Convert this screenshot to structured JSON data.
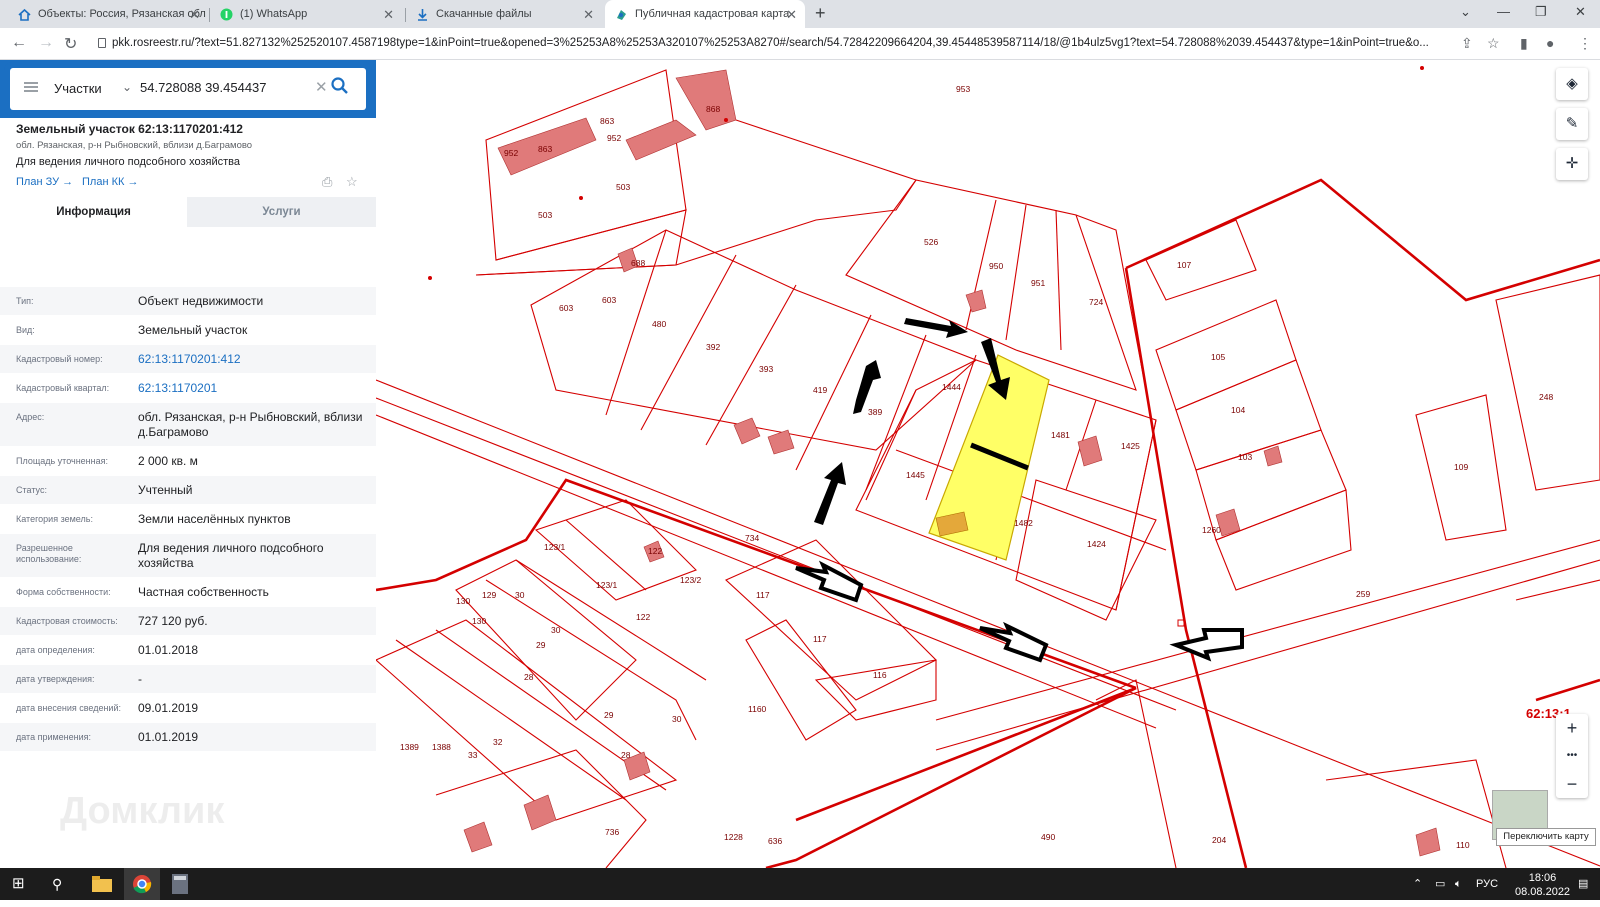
{
  "browser": {
    "tabs": [
      {
        "title": "Объекты: Россия, Рязанская обл",
        "icon": "home-icon"
      },
      {
        "title": "(1) WhatsApp",
        "icon": "whatsapp-icon"
      },
      {
        "title": "Скачанные файлы",
        "icon": "download-icon"
      },
      {
        "title": "Публичная кадастровая карта",
        "icon": "rosreestr-icon",
        "active": true
      }
    ],
    "new_tab": "+",
    "url": "pkk.rosreestr.ru/?text=51.827132%252520107.4587198type=1&inPoint=true&opened=3%25253A8%25253A320107%25253A8270#/search/54.72842209664204,39.45448539587114/18/@1b4ulz5vg1?text=54.728088%2039.454437&type=1&inPoint=true&o..."
  },
  "search": {
    "category": "Участки",
    "query": "54.728088 39.454437"
  },
  "parcel": {
    "title": "Земельный участок 62:13:1170201:412",
    "address_short": "обл. Рязанская, р-н Рыбновский, вблизи д.Баграмово",
    "use": "Для ведения личного подсобного хозяйства",
    "link_plan_zu": "План ЗУ →",
    "link_plan_kk": "План КК →"
  },
  "tabs": {
    "info": "Информация",
    "services": "Услуги"
  },
  "fields": [
    {
      "key": "Тип:",
      "value": "Объект недвижимости"
    },
    {
      "key": "Вид:",
      "value": "Земельный участок"
    },
    {
      "key": "Кадастровый номер:",
      "value": "62:13:1170201:412",
      "link": true
    },
    {
      "key": "Кадастровый квартал:",
      "value": "62:13:1170201",
      "link": true
    },
    {
      "key": "Адрес:",
      "value": "обл. Рязанская, р-н Рыбновский, вблизи д.Баграмово"
    },
    {
      "key": "Площадь уточненная:",
      "value": "2 000 кв. м"
    },
    {
      "key": "Статус:",
      "value": "Учтенный"
    },
    {
      "key": "Категория земель:",
      "value": "Земли населённых пунктов"
    },
    {
      "key": "Разрешенное использование:",
      "value": "Для ведения личного подсобного хозяйства"
    },
    {
      "key": "Форма собственности:",
      "value": "Частная собственность"
    },
    {
      "key": "Кадастровая стоимость:",
      "value": "727 120 руб."
    },
    {
      "key": "дата определения:",
      "value": "01.01.2018"
    },
    {
      "key": "дата утверждения:",
      "value": "-"
    },
    {
      "key": "дата внесения сведений:",
      "value": "09.01.2019"
    },
    {
      "key": "дата применения:",
      "value": "01.01.2019"
    }
  ],
  "map": {
    "labels": [
      "953",
      "952",
      "863",
      "863",
      "952",
      "868",
      "503",
      "503",
      "526",
      "950",
      "951",
      "724",
      "603",
      "603",
      "688",
      "480",
      "392",
      "393",
      "419",
      "389",
      "1444",
      "1481",
      "1425",
      "1445",
      "1482",
      "1424",
      "107",
      "105",
      "104",
      "103",
      "109",
      "248",
      "734",
      "122",
      "123/1",
      "123/1",
      "123/2",
      "122",
      "130",
      "129",
      "30",
      "130",
      "29",
      "30",
      "28",
      "29",
      "30",
      "28",
      "33",
      "32",
      "1388",
      "1389",
      "117",
      "117",
      "116",
      "1160",
      "259",
      "1228",
      "636",
      "736",
      "490",
      "204",
      "110",
      "1260"
    ],
    "switch_map_tooltip": "Переключить карту",
    "zoom_in": "+",
    "zoom_more": "•••",
    "zoom_out": "−",
    "quarter_label": "62:13:1"
  },
  "watermark": "Домклик",
  "taskbar": {
    "lang": "РУС",
    "time": "18:06",
    "date": "08.08.2022"
  },
  "colors": {
    "accent": "#1b6fc2",
    "parcel_line": "#d40000",
    "highlight": "#ffff66",
    "building": "#e07a7a"
  }
}
